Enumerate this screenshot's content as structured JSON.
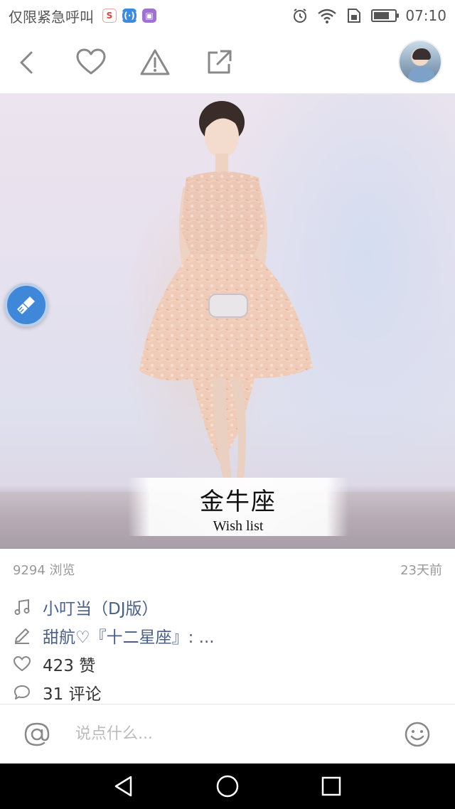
{
  "status_bar": {
    "carrier": "仅限紧急呼叫",
    "time": "07:10",
    "battery_level": 0.72,
    "icons": [
      "weibo-icon",
      "wifi-app-icon",
      "gallery-icon",
      "alarm-icon",
      "wifi-icon",
      "sim-icon",
      "battery-icon"
    ]
  },
  "toolbar": {
    "buttons": [
      "back-icon",
      "heart-icon",
      "warning-icon",
      "share-icon"
    ]
  },
  "hero": {
    "caption_title": "金牛座",
    "caption_subtitle": "Wish list"
  },
  "meta": {
    "views": "9294 浏览",
    "date": "23天前"
  },
  "info": {
    "music": "小叮当（DJ版）",
    "author": "甜航♡『十二星座』: ...",
    "likes": "423 赞",
    "comments": "31 评论"
  },
  "comment_bar": {
    "placeholder": "说点什么..."
  },
  "colors": {
    "link": "#4a5f86",
    "fab": "#3f87d8",
    "icon": "#888888"
  }
}
